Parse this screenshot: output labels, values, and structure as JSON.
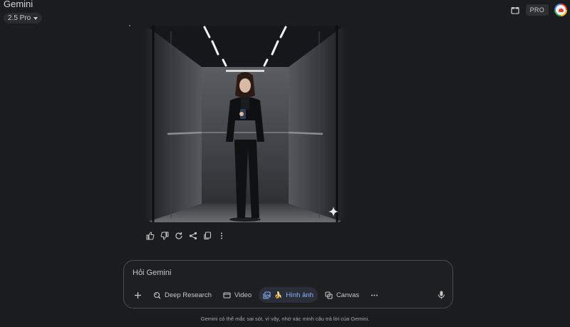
{
  "header": {
    "app_title": "Gemini",
    "model_label": "2.5 Pro",
    "pro_badge": "PRO"
  },
  "response": {
    "image_alt": "Woman in black suit taking a mirror selfie in an elevator",
    "actions": [
      "thumbs-up",
      "thumbs-down",
      "redo",
      "share",
      "copy",
      "more"
    ]
  },
  "composer": {
    "placeholder": "Hỏi Gemini",
    "tools": {
      "deep_research": "Deep Research",
      "video": "Video",
      "image": "Hình ảnh",
      "canvas": "Canvas"
    }
  },
  "footer": {
    "disclaimer": "Gemini có thể mắc sai sót, vì vậy, nhớ xác minh câu trả lời của Gemini."
  },
  "colors": {
    "background": "#1b1c1d",
    "accent": "#8ab4f8"
  }
}
